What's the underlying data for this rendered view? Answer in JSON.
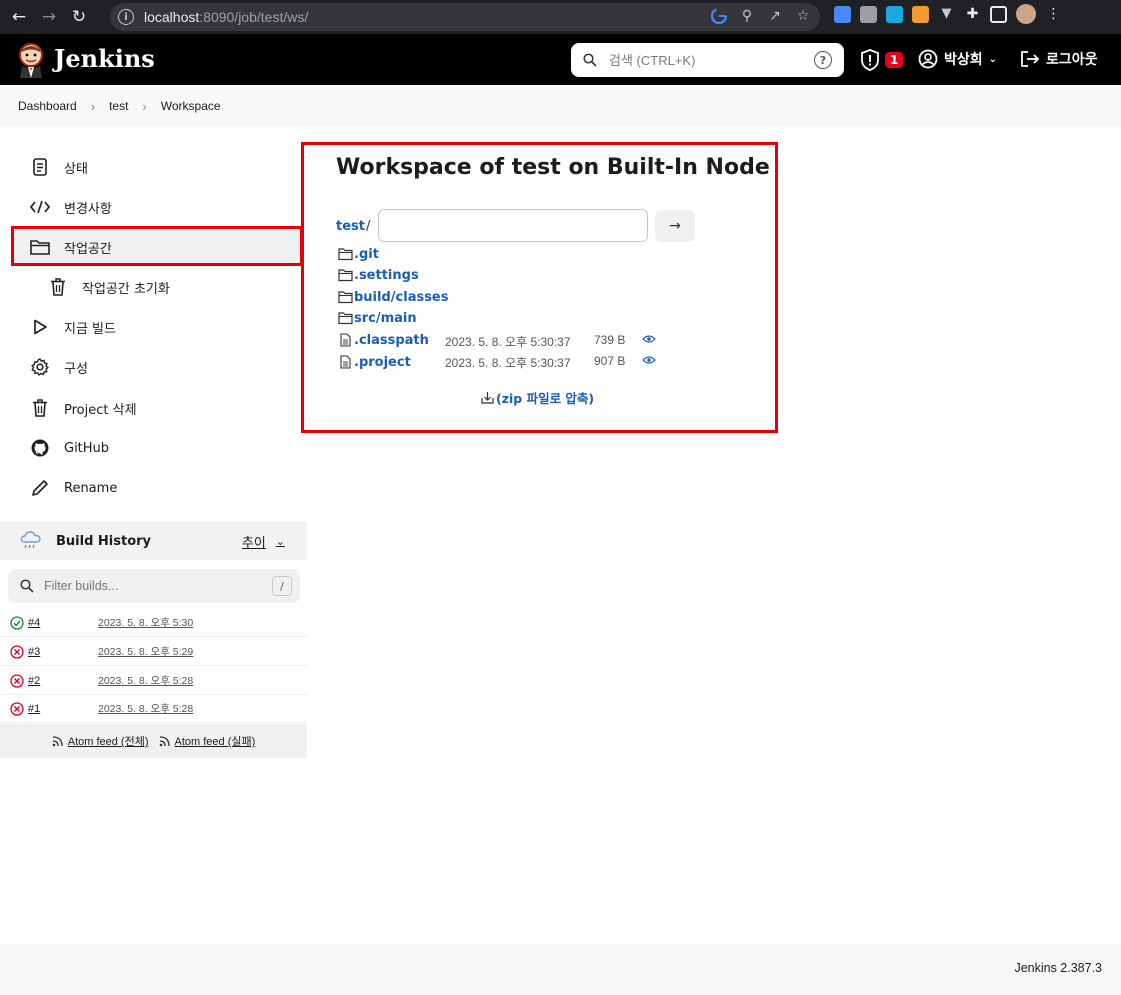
{
  "browser": {
    "url_host": "localhost",
    "url_path": ":8090/job/test/ws/"
  },
  "header": {
    "brand": "Jenkins",
    "search_placeholder": "검색 (CTRL+K)",
    "help": "?",
    "security_count": "1",
    "user": "박상희",
    "logout": "로그아웃"
  },
  "breadcrumb": [
    "Dashboard",
    "test",
    "Workspace"
  ],
  "tasks": [
    {
      "label": "상태",
      "icon": "status-icon"
    },
    {
      "label": "변경사항",
      "icon": "code-icon"
    },
    {
      "label": "작업공간",
      "icon": "folder-icon",
      "active": true
    },
    {
      "label": "작업공간 초기화",
      "icon": "trash-icon",
      "sub": true
    },
    {
      "label": "지금 빌드",
      "icon": "play-icon"
    },
    {
      "label": "구성",
      "icon": "gear-icon"
    },
    {
      "label": "Project 삭제",
      "icon": "trash-icon"
    },
    {
      "label": "GitHub",
      "icon": "github-icon"
    },
    {
      "label": "Rename",
      "icon": "pencil-icon"
    }
  ],
  "build_history": {
    "title": "Build History",
    "trend": "추이",
    "filter_placeholder": "Filter builds...",
    "filter_key": "/",
    "builds": [
      {
        "num": "#4",
        "time": "2023. 5. 8. 오후 5:30",
        "status": "success"
      },
      {
        "num": "#3",
        "time": "2023. 5. 8. 오후 5:29",
        "status": "failed"
      },
      {
        "num": "#2",
        "time": "2023. 5. 8. 오후 5:28",
        "status": "failed"
      },
      {
        "num": "#1",
        "time": "2023. 5. 8. 오후 5:28",
        "status": "failed"
      }
    ],
    "feed_all": "Atom feed (전체)",
    "feed_failed": "Atom feed (실패)"
  },
  "workspace": {
    "title": "Workspace of test on Built-In Node",
    "root": "test",
    "slash": "/",
    "dirs": [
      ".git",
      ".settings",
      "build/classes",
      "src/main"
    ],
    "files": [
      {
        "name": ".classpath",
        "date": "2023. 5. 8. 오후 5:30:37",
        "size": "739 B"
      },
      {
        "name": ".project",
        "date": "2023. 5. 8. 오후 5:30:37",
        "size": "907 B"
      }
    ],
    "zip": "(zip 파일로 압축)"
  },
  "footer": {
    "version": "Jenkins 2.387.3"
  },
  "colors": {
    "link": "#1c5db8",
    "highlight": "#e60000",
    "success": "#138a36",
    "failure": "#d4002a"
  }
}
